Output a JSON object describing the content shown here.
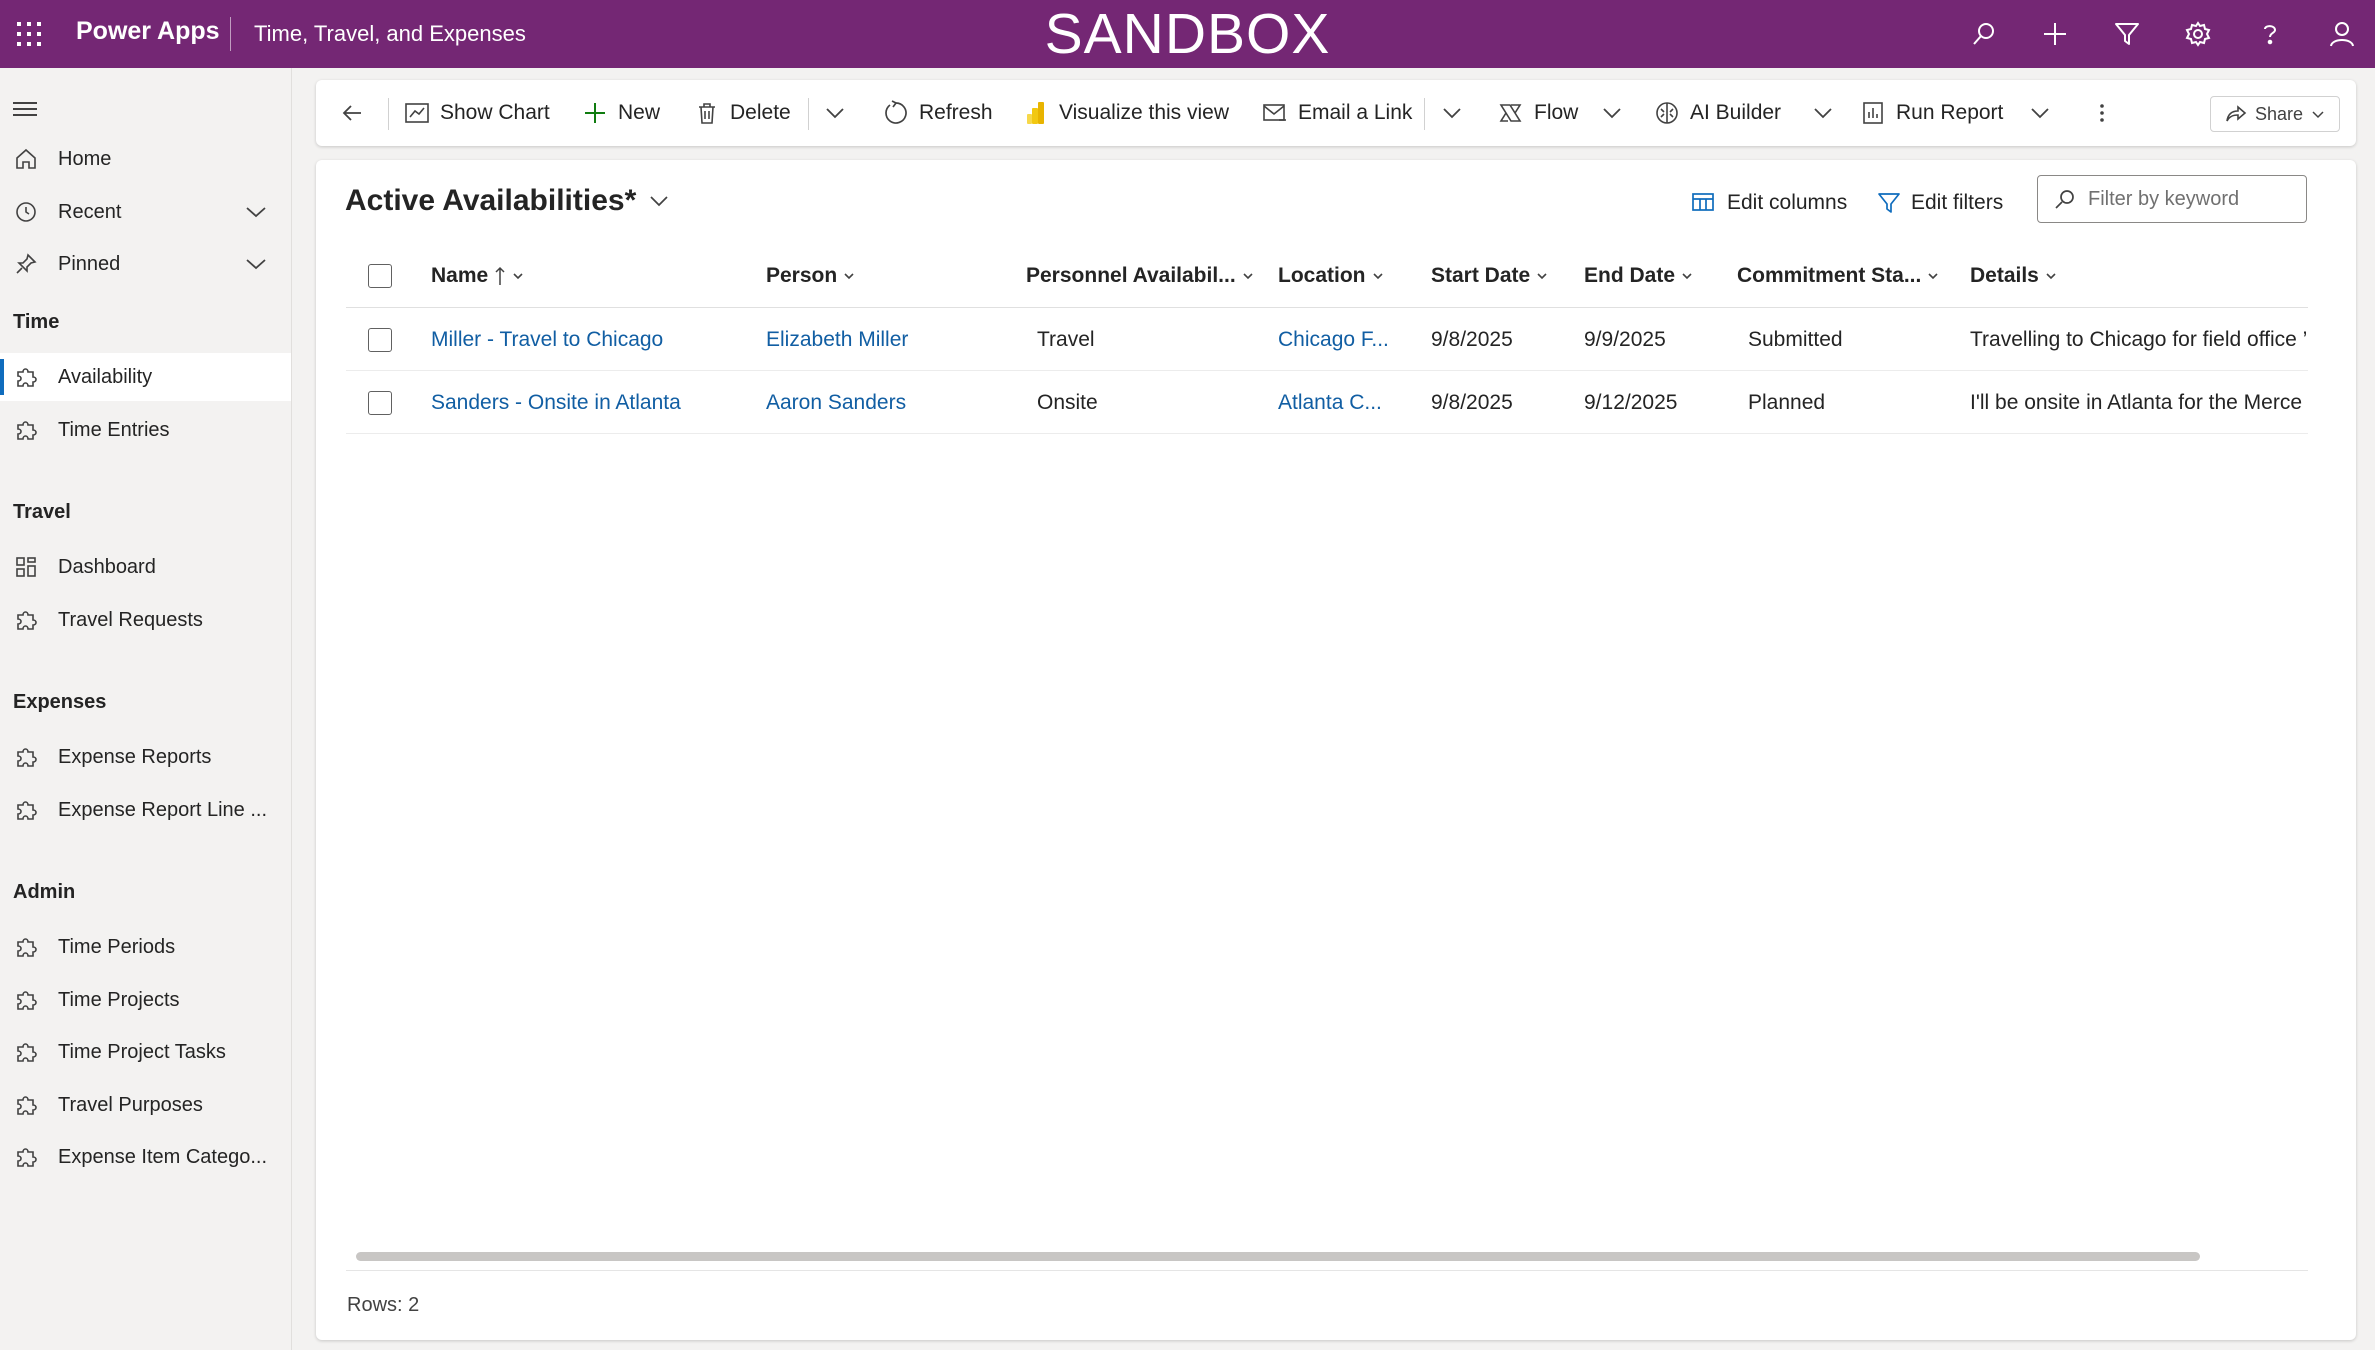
{
  "topbar": {
    "brand": "Power Apps",
    "app_title": "Time, Travel, and Expenses",
    "environment_label": "SANDBOX"
  },
  "sidebar": {
    "items": [
      {
        "label": "Home",
        "icon": "home-icon"
      },
      {
        "label": "Recent",
        "icon": "clock-icon"
      },
      {
        "label": "Pinned",
        "icon": "pin-icon"
      }
    ],
    "groups": [
      {
        "title": "Time",
        "items": [
          {
            "label": "Availability"
          },
          {
            "label": "Time Entries"
          }
        ]
      },
      {
        "title": "Travel",
        "items": [
          {
            "label": "Dashboard"
          },
          {
            "label": "Travel Requests"
          }
        ]
      },
      {
        "title": "Expenses",
        "items": [
          {
            "label": "Expense Reports"
          },
          {
            "label": "Expense Report Line ..."
          }
        ]
      },
      {
        "title": "Admin",
        "items": [
          {
            "label": "Time Periods"
          },
          {
            "label": "Time Projects"
          },
          {
            "label": "Time Project Tasks"
          },
          {
            "label": "Travel Purposes"
          },
          {
            "label": "Expense Item Catego..."
          }
        ]
      }
    ],
    "active_item": "Availability"
  },
  "commandbar": {
    "show_chart": "Show Chart",
    "new": "New",
    "delete": "Delete",
    "refresh": "Refresh",
    "visualize": "Visualize this view",
    "email_link": "Email a Link",
    "flow": "Flow",
    "ai_builder": "AI Builder",
    "run_report": "Run Report",
    "share": "Share"
  },
  "view": {
    "title": "Active Availabilities*",
    "edit_columns": "Edit columns",
    "edit_filters": "Edit filters",
    "filter_placeholder": "Filter by keyword"
  },
  "grid": {
    "columns": [
      "Name",
      "Person",
      "Personnel Availabil...",
      "Location",
      "Start Date",
      "End Date",
      "Commitment Sta...",
      "Details"
    ],
    "rows": [
      {
        "name": "Miller - Travel to Chicago",
        "person": "Elizabeth Miller",
        "availability": "Travel",
        "location": "Chicago F...",
        "start": "9/8/2025",
        "end": "9/9/2025",
        "status": "Submitted",
        "details": "Travelling to Chicago for field office ’"
      },
      {
        "name": "Sanders - Onsite in Atlanta",
        "person": "Aaron Sanders",
        "availability": "Onsite",
        "location": "Atlanta C...",
        "start": "9/8/2025",
        "end": "9/12/2025",
        "status": "Planned",
        "details": "I'll be onsite in Atlanta for the Merce"
      }
    ],
    "rows_label": "Rows: 2"
  },
  "colors": {
    "topbar": "#742774",
    "link": "#115ea3",
    "accent": "#0f6cbd"
  }
}
